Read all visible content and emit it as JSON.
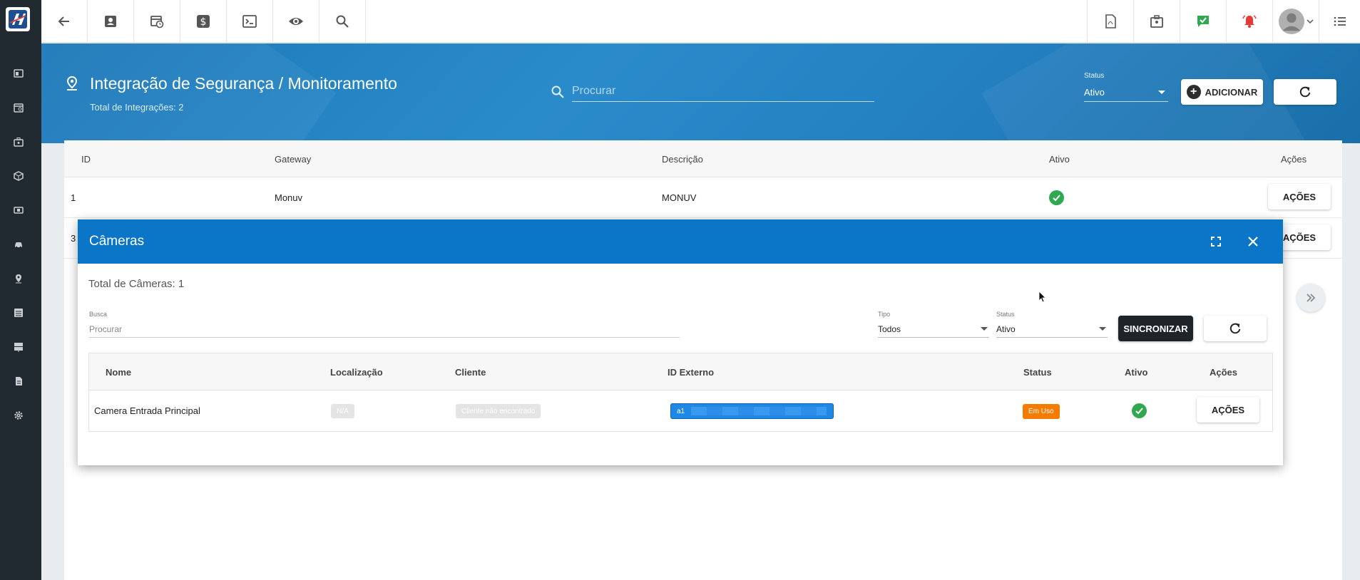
{
  "colors": {
    "sidebar": "#222a31",
    "hero": "#2385c4",
    "modal_header": "#0b76c8",
    "success": "#2fa84f",
    "warning": "#f57c00",
    "dark_button": "#1f2429",
    "chip_blue": "#1e88e5"
  },
  "sidebar": {
    "logo_icon": "brand-logo-icon",
    "items": [
      {
        "icon": "dashboard-icon"
      },
      {
        "icon": "calendar-icon"
      },
      {
        "icon": "briefcase-icon"
      },
      {
        "icon": "box-icon"
      },
      {
        "icon": "money-icon"
      },
      {
        "icon": "car-icon"
      },
      {
        "icon": "map-pin-icon"
      },
      {
        "icon": "list-icon"
      },
      {
        "icon": "server-icon"
      },
      {
        "icon": "document-icon"
      },
      {
        "icon": "gear-icon"
      }
    ]
  },
  "topbar": {
    "left_icons": [
      "back-arrow-icon",
      "contact-card-icon",
      "calendar-clock-icon",
      "dollar-icon",
      "terminal-icon",
      "eye-icon",
      "search-icon"
    ],
    "right_icons": [
      "pdf-icon",
      "calendar-badge-icon",
      "chat-check-icon",
      "alarm-bell-icon",
      "user-avatar-icon",
      "menu-list-icon"
    ]
  },
  "header": {
    "title": "Integração de Segurança / Monitoramento",
    "subtitle": "Total de Integrações: 2",
    "search_placeholder": "Procurar",
    "status_label": "Status",
    "status_value": "Ativo",
    "add_label": "ADICIONAR"
  },
  "table": {
    "columns": [
      "ID",
      "Gateway",
      "Descrição",
      "Ativo",
      "Ações"
    ],
    "rows": [
      {
        "id": "1",
        "gateway": "Monuv",
        "descricao": "MONUV",
        "ativo": true,
        "acoes": "AÇÕES"
      },
      {
        "id": "3",
        "gateway": "",
        "descricao": "",
        "ativo": true,
        "acoes": "AÇÕES"
      }
    ]
  },
  "modal": {
    "title": "Câmeras",
    "total": "Total de Câmeras: 1",
    "busca_label": "Busca",
    "busca_placeholder": "Procurar",
    "tipo_label": "Tipo",
    "tipo_value": "Todos",
    "status_label": "Status",
    "status_value": "Ativo",
    "sync_label": "SINCRONIZAR",
    "columns": [
      "Nome",
      "Localização",
      "Cliente",
      "ID Externo",
      "Status",
      "Ativo",
      "Ações"
    ],
    "row": {
      "nome": "Camera Entrada Principal",
      "localizacao": "N/A",
      "cliente": "Cliente não encontrado",
      "id_externo": "a1",
      "status": "Em Uso",
      "ativo": true,
      "acoes": "AÇÕES"
    }
  }
}
